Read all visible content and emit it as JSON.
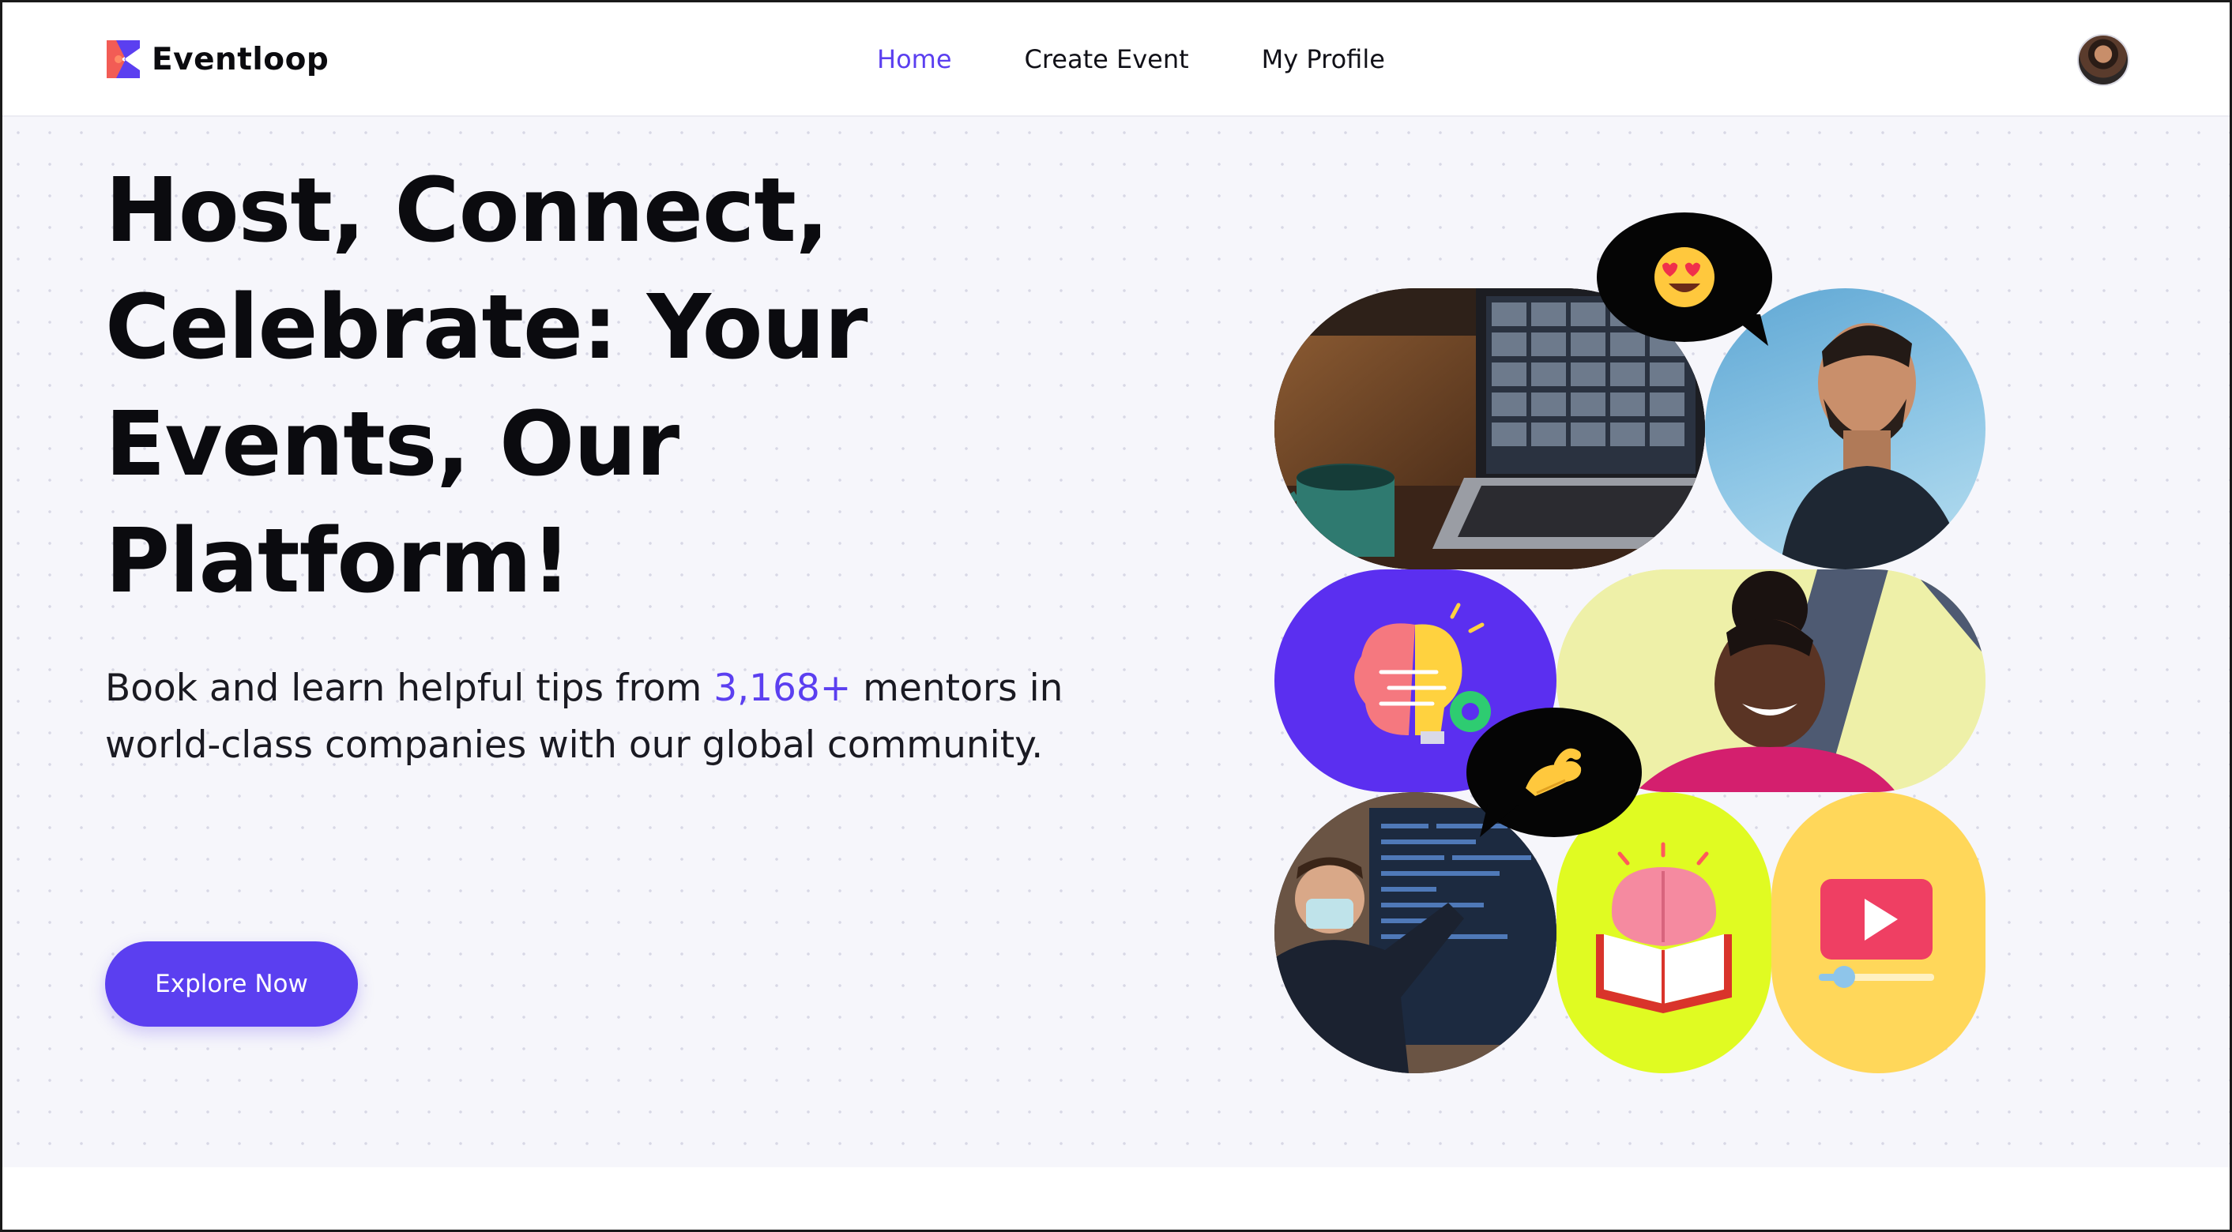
{
  "app": {
    "name": "Eventloop"
  },
  "nav": {
    "items": [
      {
        "label": "Home",
        "active": true
      },
      {
        "label": "Create Event",
        "active": false
      },
      {
        "label": "My Profile",
        "active": false
      }
    ]
  },
  "hero": {
    "headline_lines": [
      "Host, Connect,",
      "Celebrate: Your",
      "Events, Our",
      "Platform!"
    ],
    "sub_line1_prefix": "Book and learn helpful tips from ",
    "sub_highlight": "3,168+",
    "sub_line1_suffix": " mentors in",
    "sub_line2": "world-class companies with our global community.",
    "cta_label": "Explore Now"
  },
  "collage": {
    "tiles": [
      "laptop-video-call-photo",
      "laughing-man-photo",
      "brain-lightbulb-gear-icon",
      "smiling-woman-photo",
      "student-presenting-photo",
      "brain-book-icon",
      "video-player-icon"
    ],
    "bubbles": [
      "heart-eyes-emoji-icon",
      "pinching-hand-emoji-icon"
    ]
  },
  "colors": {
    "accent": "#5b3ff0",
    "lime": "#e0fb22",
    "yellow": "#ffd75a",
    "purple": "#5b2ff0"
  }
}
